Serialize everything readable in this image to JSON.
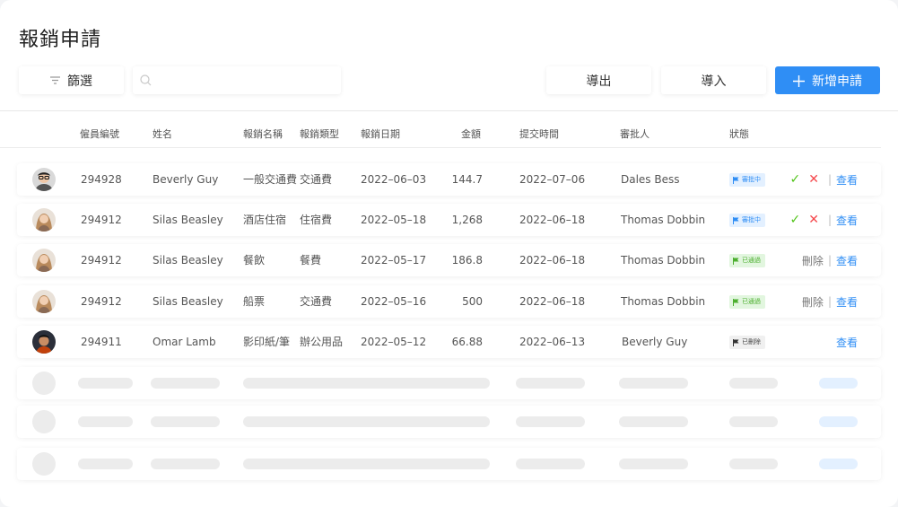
{
  "page": {
    "title": "報銷申請"
  },
  "toolbar": {
    "filter_label": "篩選",
    "search_placeholder": "",
    "export_label": "導出",
    "import_label": "導入",
    "add_label": "新增申請"
  },
  "table": {
    "headers": {
      "employee_id": "僱員編號",
      "name": "姓名",
      "expense_name": "報銷名稱",
      "expense_type": "報銷類型",
      "expense_date": "報銷日期",
      "amount": "金額",
      "submit_time": "提交時間",
      "approver": "審批人",
      "status": "狀態"
    },
    "rows": [
      {
        "employee_id": "294928",
        "name": "Beverly Guy",
        "expense_name": "一般交通費",
        "expense_type": "交通費",
        "expense_date": "2022–06–03",
        "amount": "144.7",
        "submit_time": "2022–07–06",
        "approver": "Dales Bess",
        "status": "審批中",
        "status_kind": "pending",
        "actions": {
          "approve": "✓",
          "reject": "✕",
          "view": "查看"
        },
        "avatar": "avatar-glasses-man"
      },
      {
        "employee_id": "294912",
        "name": "Silas Beasley",
        "expense_name": "酒店住宿",
        "expense_type": "住宿費",
        "expense_date": "2022–05–18",
        "amount": "1,268",
        "submit_time": "2022–06–18",
        "approver": "Thomas Dobbin",
        "status": "審批中",
        "status_kind": "pending",
        "actions": {
          "approve": "✓",
          "reject": "✕",
          "view": "查看"
        },
        "avatar": "avatar-woman"
      },
      {
        "employee_id": "294912",
        "name": "Silas Beasley",
        "expense_name": "餐飲",
        "expense_type": "餐費",
        "expense_date": "2022–05–17",
        "amount": "186.8",
        "submit_time": "2022–06–18",
        "approver": "Thomas Dobbin",
        "status": "已通過",
        "status_kind": "approved",
        "actions": {
          "delete": "刪除",
          "view": "查看"
        },
        "avatar": "avatar-woman"
      },
      {
        "employee_id": "294912",
        "name": "Silas Beasley",
        "expense_name": "船票",
        "expense_type": "交通費",
        "expense_date": "2022–05–16",
        "amount": "500",
        "submit_time": "2022–06–18",
        "approver": "Thomas Dobbin",
        "status": "已通過",
        "status_kind": "approved",
        "actions": {
          "delete": "刪除",
          "view": "查看"
        },
        "avatar": "avatar-woman"
      },
      {
        "employee_id": "294911",
        "name": "Omar Lamb",
        "expense_name": "影印紙/筆",
        "expense_type": "辦公用品",
        "expense_date": "2022–05–12",
        "amount": "66.88",
        "submit_time": "2022–06–13",
        "approver": "Beverly Guy",
        "status": "已刪除",
        "status_kind": "deleted",
        "actions": {
          "view": "查看"
        },
        "avatar": "avatar-man-dark"
      }
    ],
    "skeleton_rows": 3
  },
  "colors": {
    "accent": "#2f8ef5",
    "approved_green": "#52c41a",
    "reject_red": "#f5484c",
    "pending_badge_bg": "#e3f0ff",
    "approved_badge_bg": "#e2f6df",
    "deleted_badge_bg": "#f0f0f0"
  },
  "icons": {
    "filter": "filter-icon",
    "search": "search-icon",
    "add": "plus-icon",
    "flag": "flag-icon",
    "approve": "check-icon",
    "reject": "close-icon"
  }
}
